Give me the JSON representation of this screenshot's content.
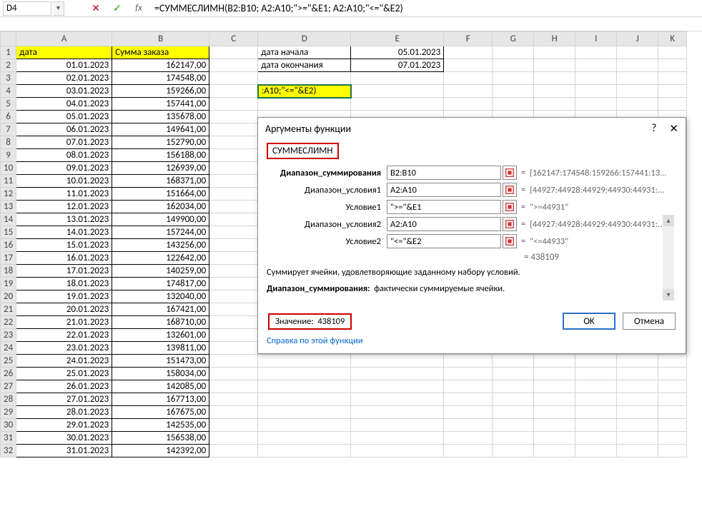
{
  "formula_bar": {
    "name_box": "D4",
    "formula": "=СУММЕСЛИМН(B2:B10; A2:A10;\">=\"&E1; A2:A10;\"<=\"&E2)"
  },
  "headers": {
    "col_a": "дата",
    "col_b": "Сумма заказа"
  },
  "side_labels": {
    "start_date": "дата начала",
    "end_date": "дата окончания"
  },
  "side_values": {
    "start_date": "05.01.2023",
    "end_date": "07.01.2023"
  },
  "active_cell_text": ":A10;\"<=\"&E2)",
  "rows": [
    {
      "r": 1
    },
    {
      "r": 2,
      "a": "01.01.2023",
      "b": "162147,00"
    },
    {
      "r": 3,
      "a": "02.01.2023",
      "b": "174548,00"
    },
    {
      "r": 4,
      "a": "03.01.2023",
      "b": "159266,00"
    },
    {
      "r": 5,
      "a": "04.01.2023",
      "b": "157441,00"
    },
    {
      "r": 6,
      "a": "05.01.2023",
      "b": "135678,00"
    },
    {
      "r": 7,
      "a": "06.01.2023",
      "b": "149641,00"
    },
    {
      "r": 8,
      "a": "07.01.2023",
      "b": "152790,00"
    },
    {
      "r": 9,
      "a": "08.01.2023",
      "b": "156188,00"
    },
    {
      "r": 10,
      "a": "09.01.2023",
      "b": "126939,00"
    },
    {
      "r": 11,
      "a": "10.01.2023",
      "b": "168371,00"
    },
    {
      "r": 12,
      "a": "11.01.2023",
      "b": "151664,00"
    },
    {
      "r": 13,
      "a": "12.01.2023",
      "b": "162034,00"
    },
    {
      "r": 14,
      "a": "13.01.2023",
      "b": "149900,00"
    },
    {
      "r": 15,
      "a": "14.01.2023",
      "b": "157244,00"
    },
    {
      "r": 16,
      "a": "15.01.2023",
      "b": "143256,00"
    },
    {
      "r": 17,
      "a": "16.01.2023",
      "b": "122642,00"
    },
    {
      "r": 18,
      "a": "17.01.2023",
      "b": "140259,00"
    },
    {
      "r": 19,
      "a": "18.01.2023",
      "b": "174817,00"
    },
    {
      "r": 20,
      "a": "19.01.2023",
      "b": "132040,00"
    },
    {
      "r": 21,
      "a": "20.01.2023",
      "b": "167421,00"
    },
    {
      "r": 22,
      "a": "21.01.2023",
      "b": "168710,00"
    },
    {
      "r": 23,
      "a": "22.01.2023",
      "b": "132601,00"
    },
    {
      "r": 24,
      "a": "23.01.2023",
      "b": "139811,00"
    },
    {
      "r": 25,
      "a": "24.01.2023",
      "b": "151473,00"
    },
    {
      "r": 26,
      "a": "25.01.2023",
      "b": "158034,00"
    },
    {
      "r": 27,
      "a": "26.01.2023",
      "b": "142085,00"
    },
    {
      "r": 28,
      "a": "27.01.2023",
      "b": "167713,00"
    },
    {
      "r": 29,
      "a": "28.01.2023",
      "b": "167675,00"
    },
    {
      "r": 30,
      "a": "29.01.2023",
      "b": "142535,00"
    },
    {
      "r": 31,
      "a": "30.01.2023",
      "b": "156538,00"
    },
    {
      "r": 32,
      "a": "31.01.2023",
      "b": "142392,00"
    }
  ],
  "dialog": {
    "title": "Аргументы функции",
    "fn_name": "СУММЕСЛИМН",
    "args": [
      {
        "label": "Диапазон_суммирования",
        "bold": true,
        "input": "B2:B10",
        "val": "{162147:174548:159266:157441:13..."
      },
      {
        "label": "Диапазон_условия1",
        "bold": false,
        "input": "A2:A10",
        "val": "{44927:44928:44929:44930:44931:..."
      },
      {
        "label": "Условие1",
        "bold": false,
        "input": "\">=\"&E1",
        "val": "\">=44931\""
      },
      {
        "label": "Диапазон_условия2",
        "bold": false,
        "input": "A2:A10",
        "val": "{44927:44928:44929:44930:44931:..."
      },
      {
        "label": "Условие2",
        "bold": false,
        "input": "\"<=\"&E2",
        "val": "\"<=44933\""
      }
    ],
    "result_eq": "=  438109",
    "desc1": "Суммирует ячейки, удовлетворяющие заданному набору условий.",
    "desc2_label": "Диапазон_суммирования:",
    "desc2_text": "фактически суммируемые ячейки.",
    "value_label": "Значение:",
    "value": "438109",
    "help": "Справка по этой функции",
    "ok": "OK",
    "cancel": "Отмена"
  },
  "cols": [
    "A",
    "B",
    "C",
    "D",
    "E",
    "F",
    "G",
    "H",
    "I",
    "J",
    "K"
  ]
}
